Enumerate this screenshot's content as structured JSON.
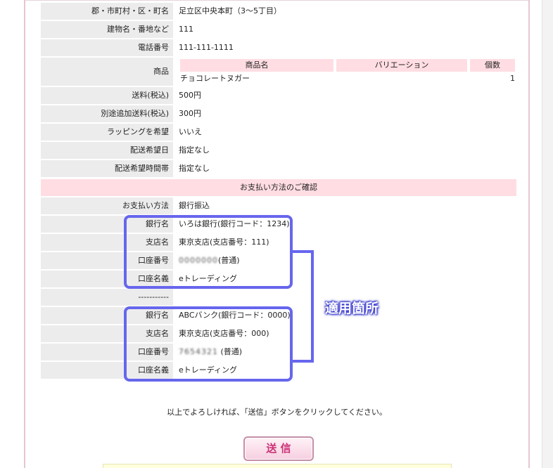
{
  "address": {
    "city_label": "郡・市町村・区・町名",
    "city_value": "足立区中央本町（3～5丁目）",
    "building_label": "建物名・番地など",
    "building_value": "111",
    "phone_label": "電話番号",
    "phone_value": "111-111-1111"
  },
  "product": {
    "label": "商品",
    "headers": [
      "商品名",
      "バリエーション",
      "個数"
    ],
    "item_name": "チョコレートヌガー",
    "item_variation": "",
    "item_qty": "1"
  },
  "fees": {
    "shipping_label": "送料(税込)",
    "shipping_value": "500円",
    "extra_label": "別途追加送料(税込)",
    "extra_value": "300円",
    "wrapping_label": "ラッピングを希望",
    "wrapping_value": "いいえ",
    "date_label": "配送希望日",
    "date_value": "指定なし",
    "time_label": "配送希望時間帯",
    "time_value": "指定なし"
  },
  "payment": {
    "section_title": "お支払い方法のご確認",
    "method_label": "お支払い方法",
    "method_value": "銀行振込",
    "banks": [
      {
        "bank_label": "銀行名",
        "bank_value": "いろは銀行(銀行コード：1234)",
        "branch_label": "支店名",
        "branch_value": "東京支店(支店番号：111)",
        "account_label": "口座番号",
        "account_value_masked": "0000000",
        "account_type": "(普通)",
        "holder_label": "口座名義",
        "holder_value": "eトレーディング"
      },
      {
        "bank_label": "銀行名",
        "bank_value": "ABCバンク(銀行コード：0000)",
        "branch_label": "支店名",
        "branch_value": "東京支店(支店番号：000)",
        "account_label": "口座番号",
        "account_value_masked": "7654321",
        "account_type": " (普通)",
        "holder_label": "口座名義",
        "holder_value": "eトレーディング"
      }
    ],
    "separator": "-----------"
  },
  "annotation": {
    "callout": "適用箇所",
    "highlight_color": "#6666ee"
  },
  "footer": {
    "notice": "以上でよろしければ、「送信」ボタンをクリックしてください。",
    "submit_label": "送 信"
  },
  "colors": {
    "label_bg": "#ececec",
    "section_bg": "#ffdde3",
    "accent": "#cc3377"
  }
}
